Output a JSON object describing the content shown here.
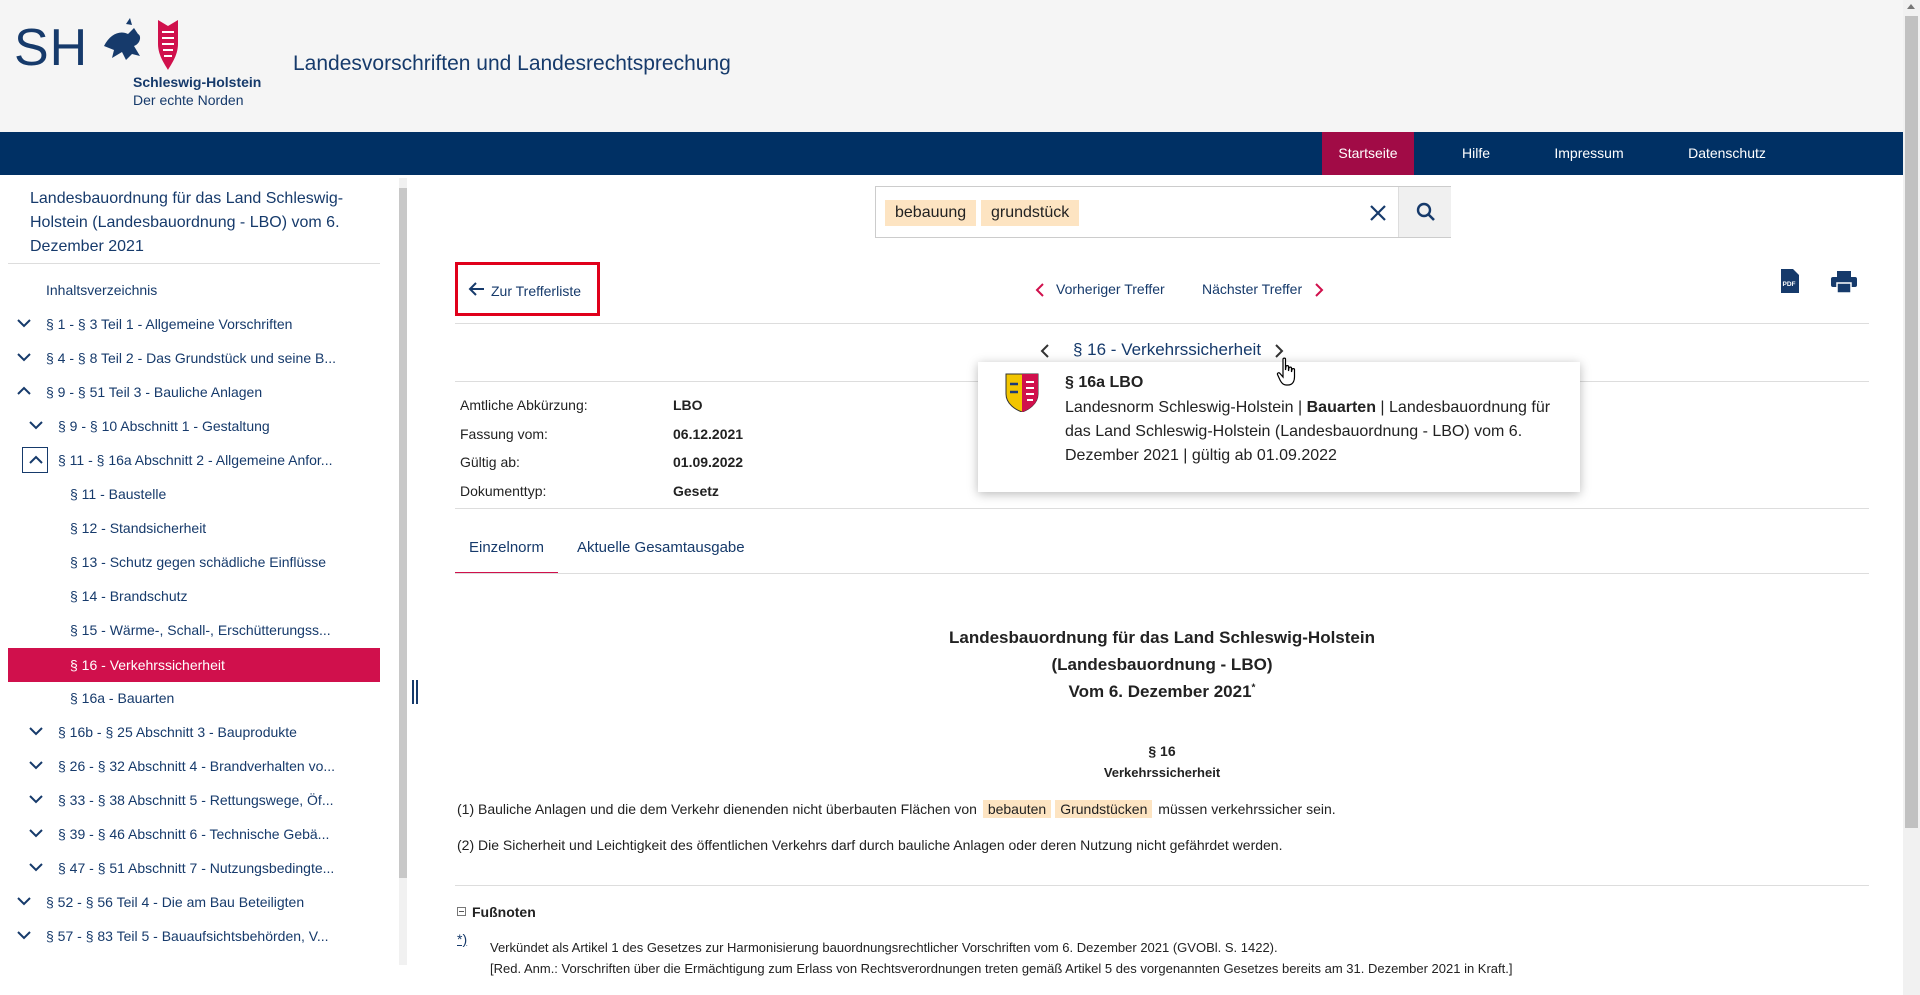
{
  "header": {
    "logo_short": "SH",
    "logo_name": "Schleswig-Holstein",
    "logo_slogan": "Der echte Norden",
    "site_title": "Landesvorschriften und Landesrechtsprechung"
  },
  "nav": {
    "items": [
      {
        "label": "Startseite",
        "active": true
      },
      {
        "label": "Hilfe",
        "active": false
      },
      {
        "label": "Impressum",
        "active": false
      },
      {
        "label": "Datenschutz",
        "active": false
      }
    ]
  },
  "sidebar": {
    "title": "Landesbauordnung für das Land Schleswig-Holstein (Landesbauordnung - LBO) vom 6. Dezember 2021",
    "toc_label": "Inhaltsverzeichnis",
    "items": [
      {
        "label": "§ 1 - § 3 Teil 1 - Allgemeine Vorschriften"
      },
      {
        "label": "§ 4 - § 8 Teil 2 - Das Grundstück und seine B..."
      },
      {
        "label": "§ 9 - § 51 Teil 3 - Bauliche Anlagen"
      },
      {
        "label": "§ 9 - § 10 Abschnitt 1 - Gestaltung"
      },
      {
        "label": "§ 11 - § 16a Abschnitt 2 - Allgemeine Anfor..."
      },
      {
        "label": "§ 11 - Baustelle"
      },
      {
        "label": "§ 12 - Standsicherheit"
      },
      {
        "label": "§ 13 - Schutz gegen schädliche Einflüsse"
      },
      {
        "label": "§ 14 - Brandschutz"
      },
      {
        "label": "§ 15 - Wärme-, Schall-, Erschütterungss..."
      },
      {
        "label": "§ 16 - Verkehrssicherheit"
      },
      {
        "label": "§ 16a - Bauarten"
      },
      {
        "label": "§ 16b - § 25 Abschnitt 3 - Bauprodukte"
      },
      {
        "label": "§ 26 - § 32 Abschnitt 4 - Brandverhalten vo..."
      },
      {
        "label": "§ 33 - § 38 Abschnitt 5 - Rettungswege, Öf..."
      },
      {
        "label": "§ 39 - § 46 Abschnitt 6 - Technische Gebä..."
      },
      {
        "label": "§ 47 - § 51 Abschnitt 7 - Nutzungsbedingte..."
      },
      {
        "label": "§ 52 - § 56 Teil 4 - Die am Bau Beteiligten"
      },
      {
        "label": "§ 57 - § 83 Teil 5 - Bauaufsichtsbehörden, V..."
      }
    ]
  },
  "search": {
    "tags": [
      "bebauung",
      "grundstück"
    ]
  },
  "toolbar": {
    "back_label": "Zur Trefferliste",
    "prev_hit": "Vorheriger Treffer",
    "next_hit": "Nächster Treffer",
    "pdf_icon": "pdf-icon",
    "print_icon": "print-icon"
  },
  "paragraph_nav": {
    "current": "§ 16 - Verkehrssicherheit"
  },
  "meta": {
    "rows": [
      {
        "label": "Amtliche Abkürzung:",
        "value": "LBO"
      },
      {
        "label": "Fassung vom:",
        "value": "06.12.2021"
      },
      {
        "label": "Gültig ab:",
        "value": "01.09.2022"
      },
      {
        "label": "Dokumenttyp:",
        "value": "Gesetz"
      }
    ]
  },
  "tooltip": {
    "title": "§ 16a LBO",
    "body_pre": "Landesnorm Schleswig-Holstein | ",
    "body_bold": "Bauarten",
    "body_post": " | Landesbauordnung für das Land Schleswig-Holstein (Landesbauordnung - LBO) vom 6. Dezember 2021 | gültig ab 01.09.2022"
  },
  "tabs": [
    {
      "label": "Einzelnorm",
      "active": true
    },
    {
      "label": "Aktuelle Gesamtausgabe",
      "active": false
    }
  ],
  "document": {
    "title_line1": "Landesbauordnung für das Land Schleswig-Holstein",
    "title_line2": "(Landesbauordnung - LBO)",
    "title_line3": "Vom 6. Dezember 2021",
    "title_sup": "*",
    "section_num": "§ 16",
    "section_title": "Verkehrssicherheit",
    "para1_pre": "(1) Bauliche Anlagen und die dem Verkehr dienenden nicht überbauten Flächen von",
    "para1_hl1": "bebauten",
    "para1_hl2": "Grundstücken",
    "para1_post": "müssen verkehrssicher sein.",
    "para2": "(2) Die Sicherheit und Leichtigkeit des öffentlichen Verkehrs darf durch bauliche Anlagen oder deren Nutzung nicht gefährdet werden.",
    "footnotes_label": "Fußnoten",
    "footnote_ref": "*)",
    "footnote_line1": "Verkündet als Artikel 1 des Gesetzes zur Harmonisierung bauordnungsrechtlicher Vorschriften vom 6. Dezember 2021 (GVOBl. S. 1422).",
    "footnote_line2": "[Red. Anm.: Vorschriften über die Ermächtigung zum Erlass von Rechtsverordnungen treten gemäß Artikel 5 des vorgenannten Gesetzes bereits am 31. Dezember 2021 in Kraft.]"
  },
  "colors": {
    "navy": "#003064",
    "accent": "#d0104c",
    "nav_active": "#a10b46",
    "highlight": "#fde4c2",
    "focus_outline": "#e0001b"
  }
}
